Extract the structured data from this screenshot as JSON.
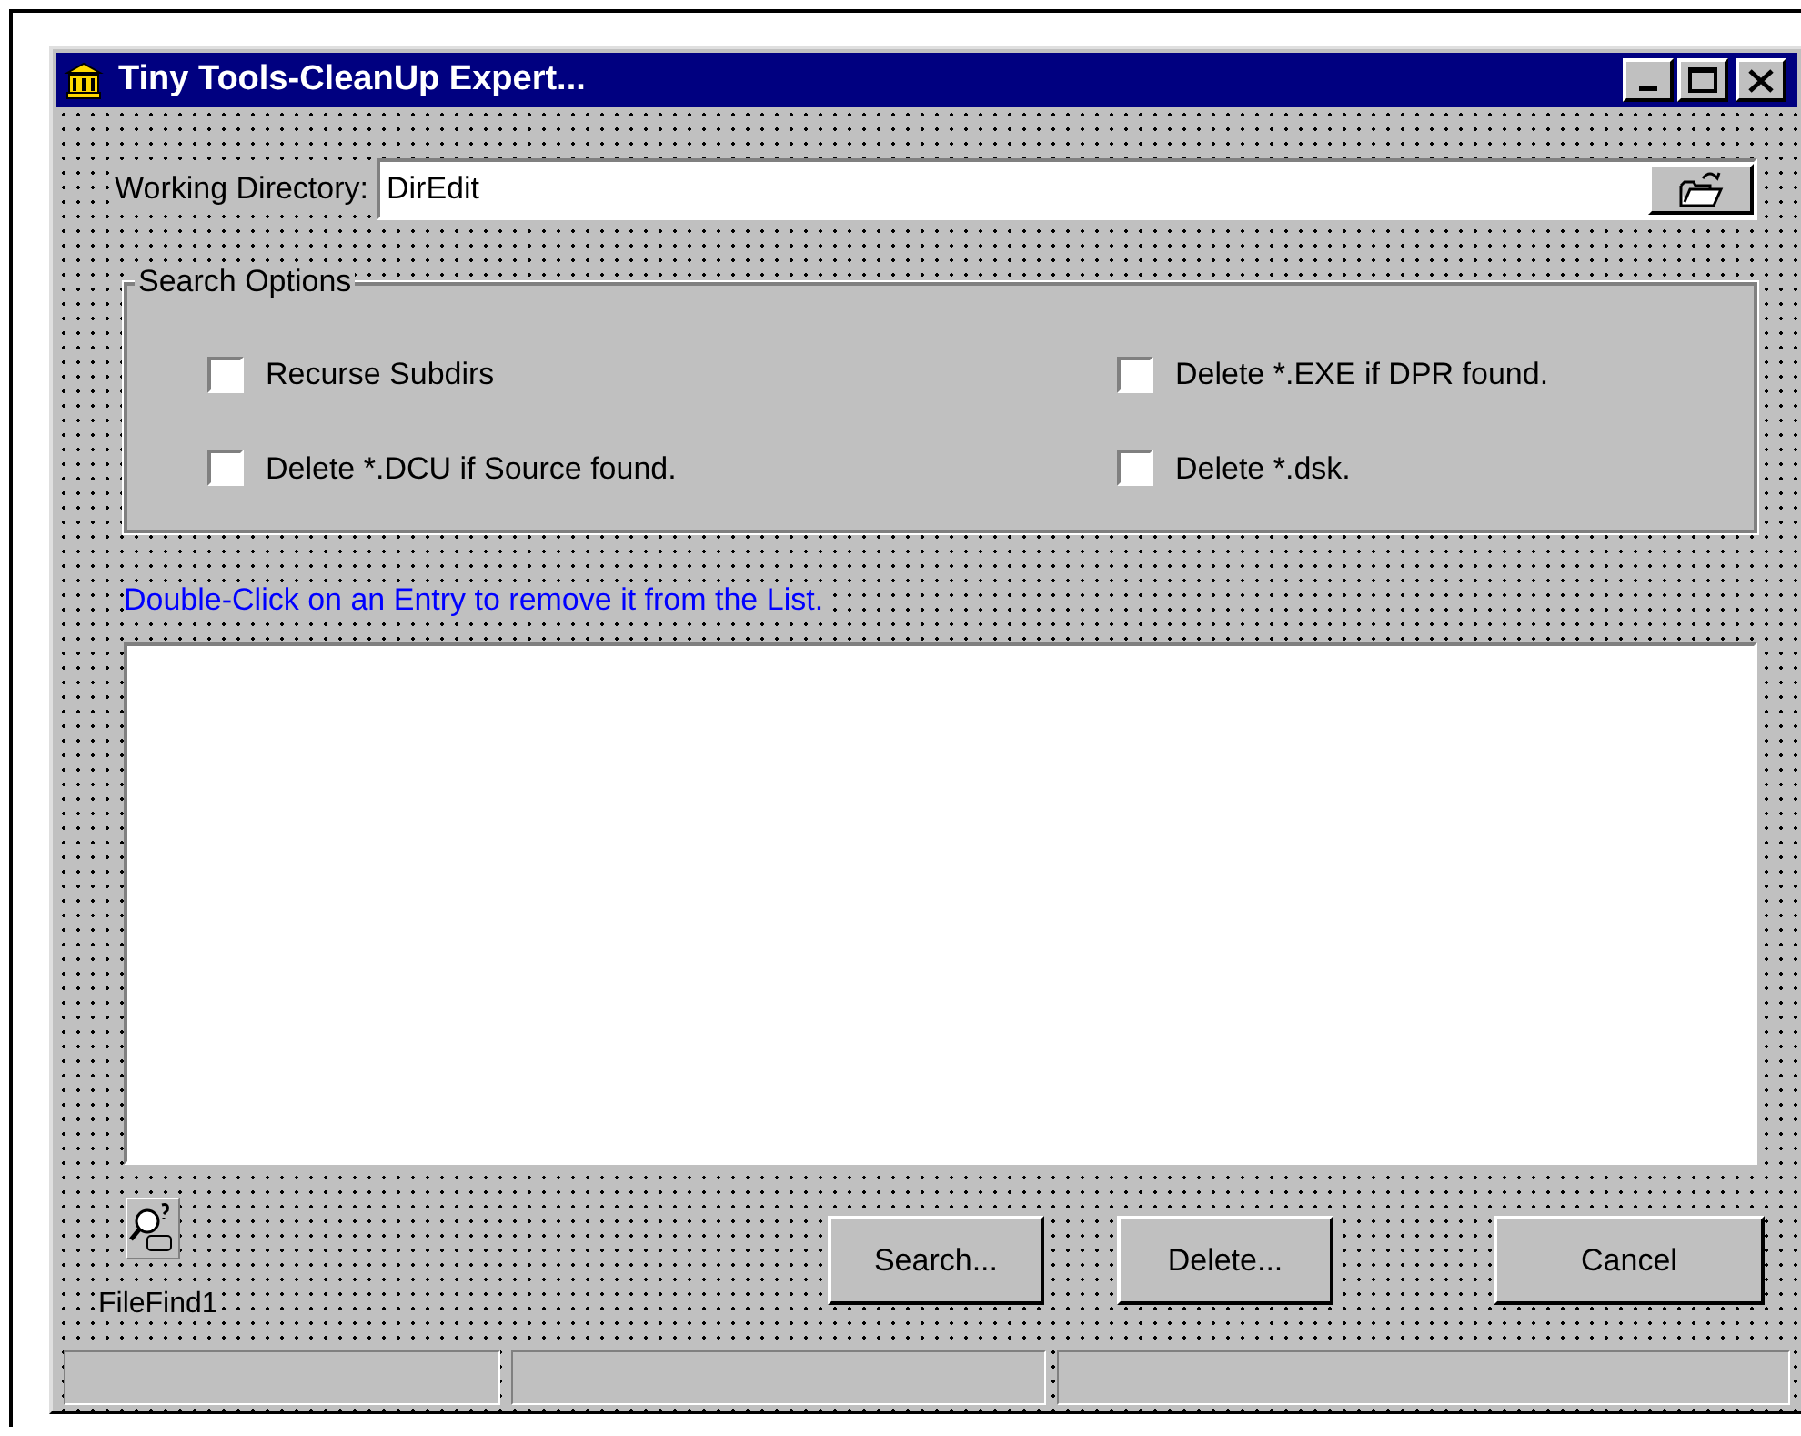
{
  "window": {
    "title": "Tiny Tools-CleanUp Expert..."
  },
  "working_directory": {
    "label": "Working Directory:",
    "value": "DirEdit"
  },
  "search_options": {
    "title": "Search Options",
    "options": [
      {
        "label": "Recurse Subdirs",
        "checked": false
      },
      {
        "label": "Delete *.EXE if DPR found.",
        "checked": false
      },
      {
        "label": "Delete *.DCU if Source found.",
        "checked": false
      },
      {
        "label": "Delete *.dsk.",
        "checked": false
      }
    ]
  },
  "hint": "Double-Click on an Entry to remove it from the List.",
  "component_label": "FileFind1",
  "buttons": [
    "Search...",
    "Delete...",
    "Cancel"
  ]
}
